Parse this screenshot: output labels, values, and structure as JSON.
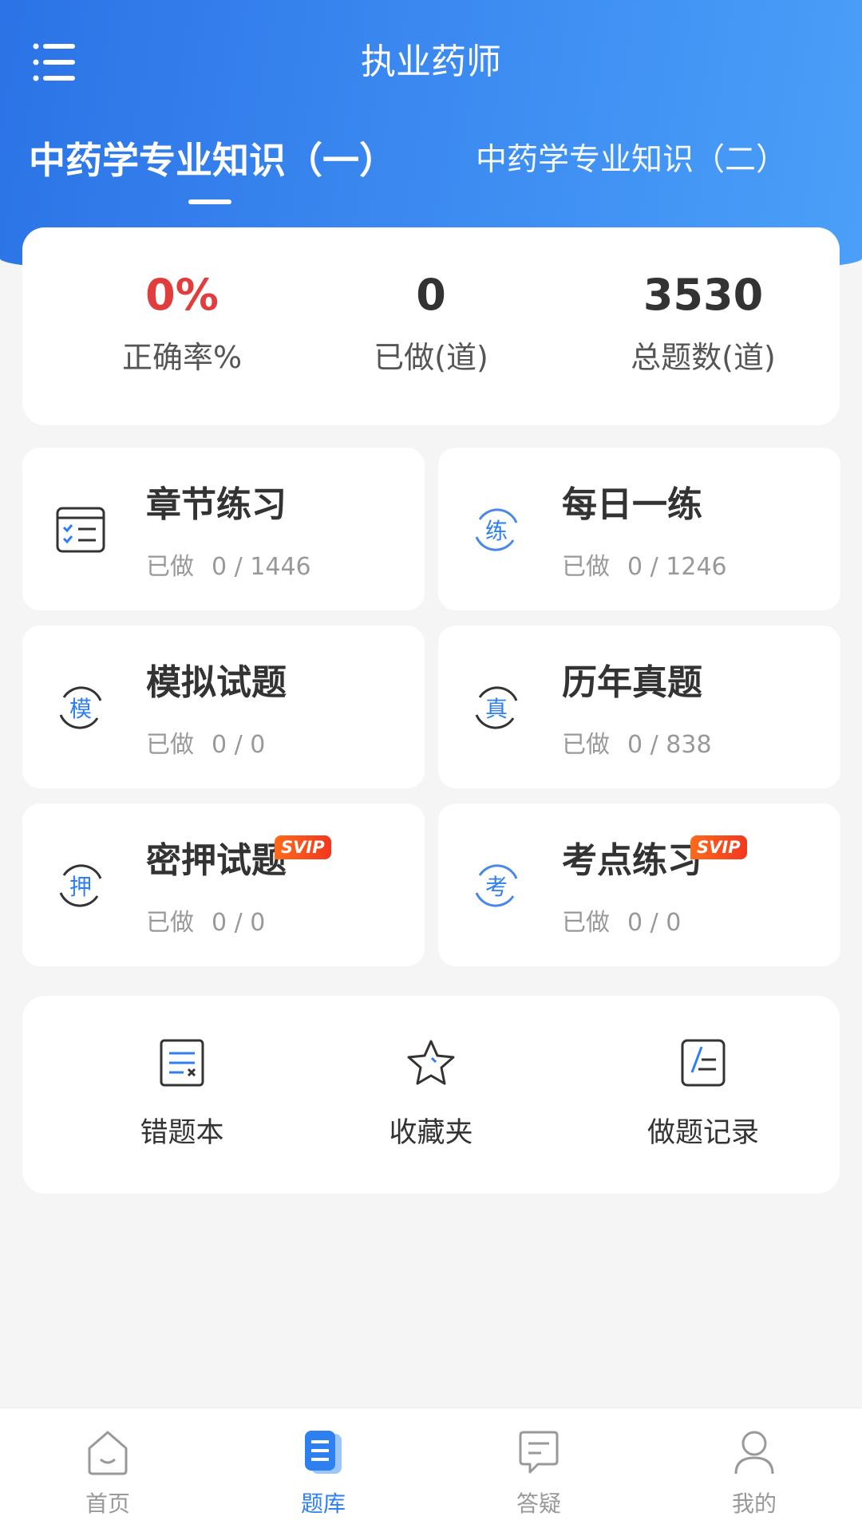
{
  "header": {
    "title": "执业药师",
    "tabs": [
      {
        "label": "中药学专业知识（一）",
        "active": true
      },
      {
        "label": "中药学专业知识（二）",
        "active": false
      }
    ]
  },
  "stats": [
    {
      "value": "0%",
      "label": "正确率%"
    },
    {
      "value": "0",
      "label": "已做(道)"
    },
    {
      "value": "3530",
      "label": "总题数(道)"
    }
  ],
  "practice": [
    {
      "name": "章节练习",
      "done_label": "已做",
      "progress": "0 / 1446",
      "icon": "checklist-icon"
    },
    {
      "name": "每日一练",
      "done_label": "已做",
      "progress": "0 / 1246",
      "icon": "daily-practice-icon",
      "icon_char": "练"
    },
    {
      "name": "模拟试题",
      "done_label": "已做",
      "progress": "0 / 0",
      "icon": "mock-exam-icon",
      "icon_char": "模"
    },
    {
      "name": "历年真题",
      "done_label": "已做",
      "progress": "0 / 838",
      "icon": "past-exam-icon",
      "icon_char": "真"
    },
    {
      "name": "密押试题",
      "done_label": "已做",
      "progress": "0 / 0",
      "icon": "secret-exam-icon",
      "icon_char": "押",
      "badge": "SVIP"
    },
    {
      "name": "考点练习",
      "done_label": "已做",
      "progress": "0 / 0",
      "icon": "key-point-icon",
      "icon_char": "考",
      "badge": "SVIP"
    }
  ],
  "tools": [
    {
      "label": "错题本",
      "icon": "wrong-book-icon"
    },
    {
      "label": "收藏夹",
      "icon": "star-icon"
    },
    {
      "label": "做题记录",
      "icon": "record-icon"
    }
  ],
  "nav": [
    {
      "label": "首页",
      "icon": "home-icon",
      "active": false
    },
    {
      "label": "题库",
      "icon": "question-bank-icon",
      "active": true
    },
    {
      "label": "答疑",
      "icon": "qa-icon",
      "active": false
    },
    {
      "label": "我的",
      "icon": "profile-icon",
      "active": false
    }
  ],
  "colors": {
    "primary": "#2e7ff0",
    "header_start": "#2b73e6",
    "header_end": "#4aa0f8",
    "accent_red": "#e23c3c",
    "svip_orange": "#f2371f",
    "background": "#f5f5f6"
  }
}
